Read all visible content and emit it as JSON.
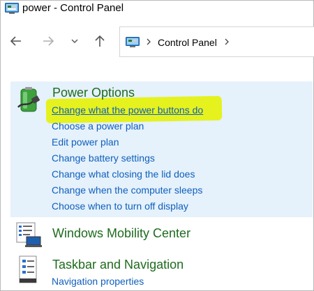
{
  "window": {
    "title": "power - Control Panel"
  },
  "address_bar": {
    "crumb": "Control Panel"
  },
  "categories": [
    {
      "title": "Power Options",
      "links": [
        "Change what the power buttons do",
        "Choose a power plan",
        "Edit power plan",
        "Change battery settings",
        "Change what closing the lid does",
        "Change when the computer sleeps",
        "Choose when to turn off display"
      ]
    },
    {
      "title": "Windows Mobility Center",
      "links": []
    },
    {
      "title": "Taskbar and Navigation",
      "links": [
        "Navigation properties"
      ]
    }
  ],
  "colors": {
    "category_title": "#1e6b1e",
    "link": "#0f5fbd",
    "selection_bg": "#e5f1fb",
    "highlighter": "#e5f21e"
  },
  "icons": {
    "app": "control-panel-icon",
    "back": "back-arrow-icon",
    "forward": "forward-arrow-icon",
    "recent": "chevron-down-icon",
    "up": "up-arrow-icon",
    "power": "battery-power-icon",
    "mobility": "mobility-center-icon",
    "taskbar": "taskbar-icon"
  }
}
